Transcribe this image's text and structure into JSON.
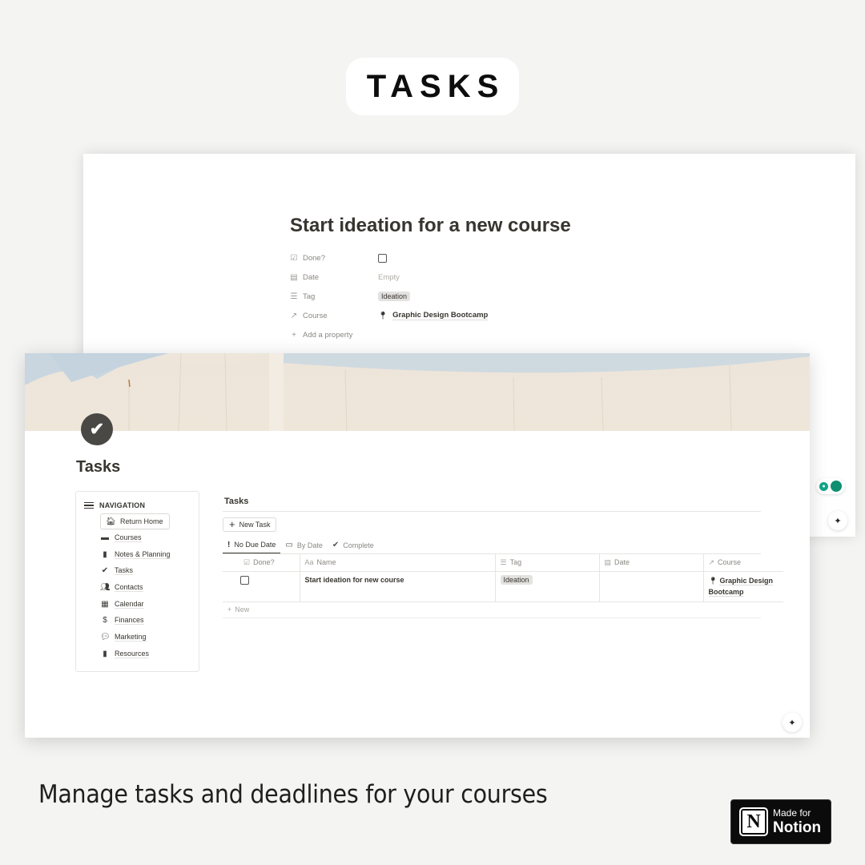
{
  "hero": {
    "title": "TASKS"
  },
  "back_window": {
    "page_title": "Start ideation for a new course",
    "properties": [
      {
        "icon": "checkbox-icon",
        "glyph": "☑",
        "label": "Done?",
        "type": "checkbox",
        "value": ""
      },
      {
        "icon": "calendar-icon",
        "glyph": "▤",
        "label": "Date",
        "type": "empty",
        "value": "Empty"
      },
      {
        "icon": "list-icon",
        "glyph": "☰",
        "label": "Tag",
        "type": "tag",
        "value": "Ideation"
      },
      {
        "icon": "arrow-up-right-icon",
        "glyph": "↗",
        "label": "Course",
        "type": "relation",
        "value": "Graphic Design Bootcamp"
      }
    ],
    "add_property": "Add a property",
    "add_property_glyph": "+"
  },
  "front_window": {
    "page_title": "Tasks",
    "page_icon_glyph": "✔",
    "navigation": {
      "heading": "NAVIGATION",
      "items": [
        {
          "label": "Return Home",
          "glyph": "🏠︎",
          "icon": "home-icon"
        },
        {
          "label": "Courses",
          "glyph": "▬",
          "icon": "archive-icon"
        },
        {
          "label": "Notes & Planning",
          "glyph": "▮",
          "icon": "document-icon"
        },
        {
          "label": "Tasks",
          "glyph": "✔",
          "icon": "check-circle-icon"
        },
        {
          "label": "Contacts",
          "glyph": "👥︎",
          "icon": "people-icon"
        },
        {
          "label": "Calendar",
          "glyph": "▦",
          "icon": "calendar-icon"
        },
        {
          "label": "Finances",
          "glyph": "$",
          "icon": "money-icon"
        },
        {
          "label": "Marketing",
          "glyph": "💬︎",
          "icon": "chat-bubbles-icon"
        },
        {
          "label": "Resources",
          "glyph": "▮",
          "icon": "book-icon"
        }
      ]
    },
    "database": {
      "title": "Tasks",
      "new_button": "New Task",
      "new_button_glyph": "+",
      "views": [
        {
          "label": "No Due Date",
          "glyph": "!",
          "active": true
        },
        {
          "label": "By Date",
          "glyph": "▭",
          "active": false
        },
        {
          "label": "Complete",
          "glyph": "✔",
          "active": false
        }
      ],
      "columns": [
        {
          "label": "Done?",
          "glyph": "☑"
        },
        {
          "label": "Name",
          "glyph": "Aa"
        },
        {
          "label": "Tag",
          "glyph": "☰"
        },
        {
          "label": "Date",
          "glyph": "▤"
        },
        {
          "label": "Course",
          "glyph": "↗"
        }
      ],
      "rows": [
        {
          "done": false,
          "name": "Start ideation for new course",
          "tag": "Ideation",
          "date": "",
          "course": "Graphic Design Bootcamp"
        }
      ],
      "new_row_label": "New"
    }
  },
  "caption": "Manage tasks and deadlines for your courses",
  "badge": {
    "small": "Made for",
    "big": "Notion",
    "logo": "N"
  },
  "colors": {
    "accent_green": "#12a589",
    "text": "#37352f",
    "badge_bg": "#0b0b0b"
  }
}
